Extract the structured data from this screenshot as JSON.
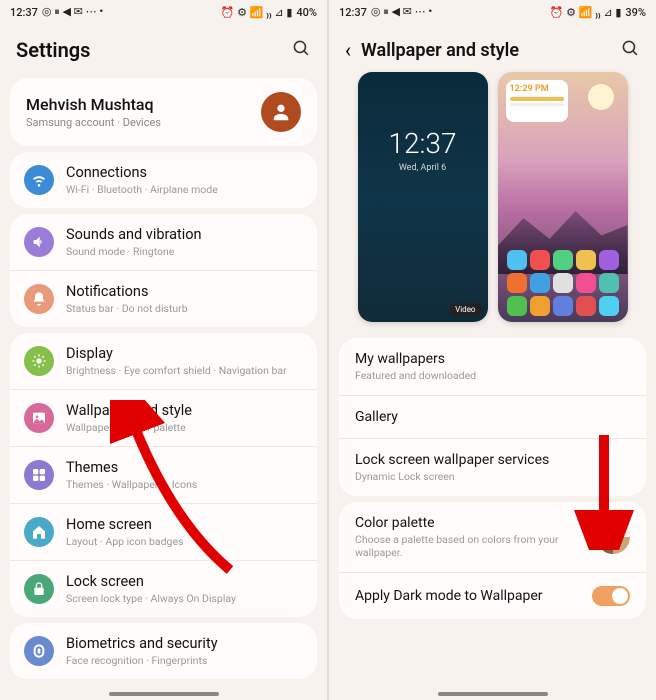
{
  "left": {
    "status": {
      "time": "12:37",
      "icons_left": "◎ ⏸ ◀ ✉ ⋯ •",
      "icons_right": "⏰ ⚙ 📶 ₎₎ ⊿ ▮",
      "battery": "40%"
    },
    "title": "Settings",
    "account": {
      "name": "Mehvish Mushtaq",
      "sub": "Samsung account · Devices"
    },
    "groups": [
      {
        "items": [
          {
            "icon": "wifi",
            "color": "#3b8bd6",
            "title": "Connections",
            "sub": "Wi-Fi · Bluetooth · Airplane mode"
          }
        ]
      },
      {
        "items": [
          {
            "icon": "sound",
            "color": "#9a7dd8",
            "title": "Sounds and vibration",
            "sub": "Sound mode · Ringtone"
          },
          {
            "icon": "bell",
            "color": "#e89a7a",
            "title": "Notifications",
            "sub": "Status bar · Do not disturb"
          }
        ]
      },
      {
        "items": [
          {
            "icon": "sun",
            "color": "#86c04a",
            "title": "Display",
            "sub": "Brightness · Eye comfort shield · Navigation bar"
          },
          {
            "icon": "image",
            "color": "#d86a9a",
            "title": "Wallpaper and style",
            "sub": "Wallpapers · Color palette"
          },
          {
            "icon": "theme",
            "color": "#8a7ad0",
            "title": "Themes",
            "sub": "Themes · Wallpapers · Icons"
          },
          {
            "icon": "home",
            "color": "#4aa8c8",
            "title": "Home screen",
            "sub": "Layout · App icon badges"
          },
          {
            "icon": "lock",
            "color": "#4aa878",
            "title": "Lock screen",
            "sub": "Screen lock type · Always On Display"
          }
        ]
      },
      {
        "items": [
          {
            "icon": "finger",
            "color": "#6a8ad0",
            "title": "Biometrics and security",
            "sub": "Face recognition · Fingerprints"
          }
        ]
      }
    ]
  },
  "right": {
    "status": {
      "time": "12:37",
      "icons_left": "◎ ⏸ ◀ ✉ ⋯ •",
      "icons_right": "⏰ ⚙ 📶 ₎₎ ⊿ ▮",
      "battery": "39%"
    },
    "title": "Wallpaper and style",
    "lock_preview": {
      "time": "12:37",
      "date": "Wed, April 6",
      "video_badge": "Video"
    },
    "home_preview": {
      "widget_time": "12:29 PM"
    },
    "options1": [
      {
        "title": "My wallpapers",
        "sub": "Featured and downloaded"
      },
      {
        "title": "Gallery",
        "sub": ""
      },
      {
        "title": "Lock screen wallpaper services",
        "sub": "Dynamic Lock screen"
      }
    ],
    "color_palette": {
      "title": "Color palette",
      "sub": "Choose a palette based on colors from your wallpaper."
    },
    "dark_mode": {
      "title": "Apply Dark mode to Wallpaper"
    }
  }
}
